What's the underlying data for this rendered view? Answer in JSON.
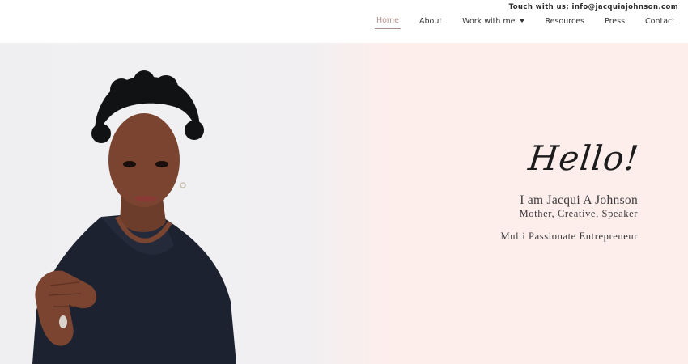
{
  "header": {
    "contact_label": "Touch with us: info@jacquiajohnson.com",
    "nav": [
      {
        "label": "Home",
        "active": true
      },
      {
        "label": "About"
      },
      {
        "label": "Work with me",
        "has_dropdown": true
      },
      {
        "label": "Resources"
      },
      {
        "label": "Press"
      },
      {
        "label": "Contact"
      }
    ]
  },
  "hero": {
    "greeting": "Hello!",
    "name_line": "I am Jacqui A Johnson",
    "roles_line": "Mother, Creative, Speaker",
    "tagline": "Multi Passionate Entrepreneur"
  },
  "colors": {
    "accent": "#b08f8a",
    "hero_left_bg": "#efeff1",
    "hero_right_bg": "#fdeeec",
    "text": "#333333"
  }
}
